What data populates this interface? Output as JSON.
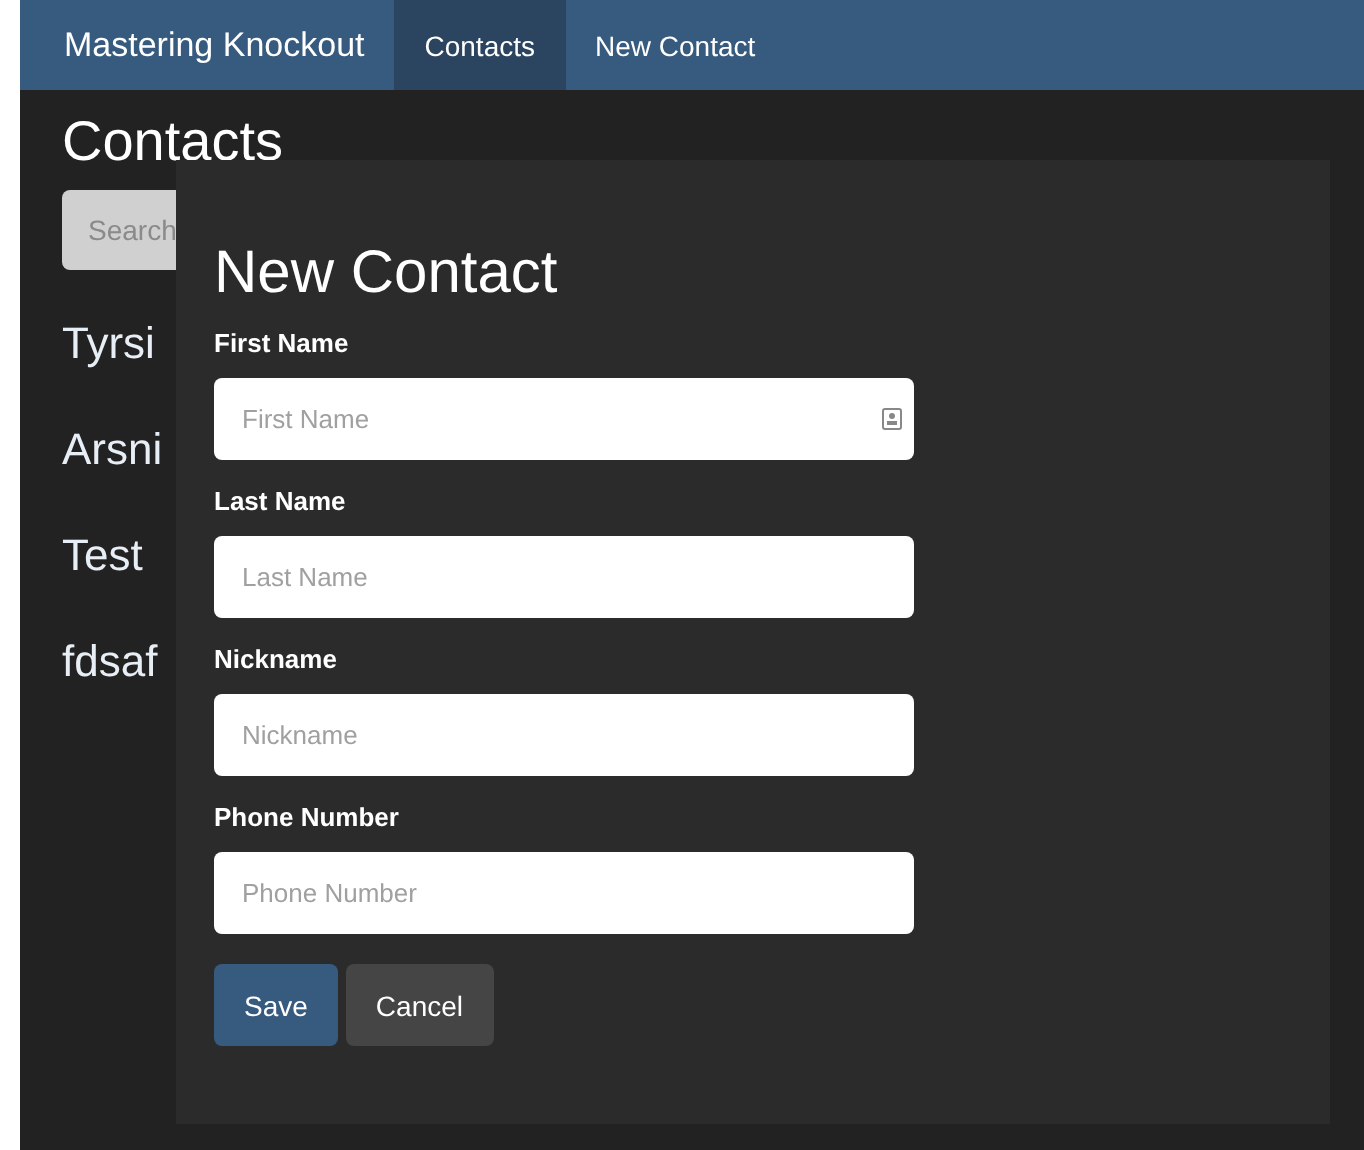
{
  "navbar": {
    "brand": "Mastering Knockout",
    "links": [
      {
        "label": "Contacts",
        "selected": true
      },
      {
        "label": "New Contact",
        "selected": false
      }
    ]
  },
  "page": {
    "title": "Contacts",
    "search": {
      "placeholder": "Search"
    },
    "contacts": [
      "Tyrsi",
      "Arsni",
      "Test",
      "fdsaf"
    ]
  },
  "dialog": {
    "title": "New Contact",
    "fields": [
      {
        "label": "First Name",
        "placeholder": "First Name",
        "autofill_icon": true
      },
      {
        "label": "Last Name",
        "placeholder": "Last Name",
        "autofill_icon": false
      },
      {
        "label": "Nickname",
        "placeholder": "Nickname",
        "autofill_icon": false
      },
      {
        "label": "Phone Number",
        "placeholder": "Phone Number",
        "autofill_icon": false
      }
    ],
    "buttons": [
      {
        "label": "Save",
        "kind": "primary"
      },
      {
        "label": "Cancel",
        "kind": "default"
      }
    ]
  }
}
